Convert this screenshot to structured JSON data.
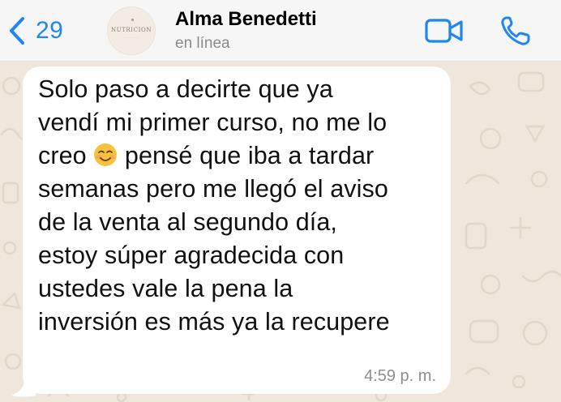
{
  "header": {
    "back_count": "29",
    "contact_name": "Alma Benedetti",
    "contact_status": "en línea",
    "avatar_brand": "NUTRICION",
    "back_icon": "chevron-left-icon",
    "video_icon": "video-camera-icon",
    "call_icon": "phone-icon"
  },
  "message": {
    "lines": [
      "Solo paso a decirte que ya",
      "vendí mi primer curso, no me lo",
      "creo",
      "pensé que iba a tardar",
      "semanas pero me llegó el aviso",
      "de la venta al segundo día,",
      "estoy súper agradecida con",
      "ustedes vale la pena la",
      "inversión es más ya la recupere"
    ],
    "emoji": "☺️",
    "time": "4:59 p. m."
  },
  "colors": {
    "accent": "#1f86f0",
    "bubble": "#ffffff",
    "wallpaper": "#efe7dc",
    "header": "#f6f6f6"
  }
}
